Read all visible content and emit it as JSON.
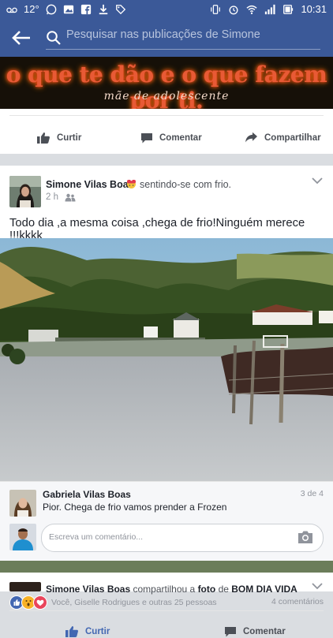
{
  "status_bar": {
    "temperature": "12°",
    "time": "10:31"
  },
  "search": {
    "placeholder": "Pesquisar nas publicações de Simone"
  },
  "banner": {
    "title": "o que te dão e o que fazem por ti.",
    "subtitle": "mãe de adolescente"
  },
  "top_actions": {
    "like": "Curtir",
    "comment": "Comentar",
    "share": "Compartilhar"
  },
  "post": {
    "author": "Simone Vilas Boas",
    "feeling": "sentindo-se com frio.",
    "time": "2 h",
    "text": "Todo dia ,a mesma coisa ,chega de frio!Ninguém merece !!!kkkk",
    "reactions_label": "Você, Giselle Rodrigues e outras 25 pessoas",
    "comments_count": "4 comentários",
    "actions": {
      "like": "Curtir",
      "comment": "Comentar"
    }
  },
  "comment": {
    "author": "Gabriela Vilas Boas",
    "text": "Pior. Chega de frio vamos prender a Frozen",
    "position": "3 de 4"
  },
  "comment_input": {
    "placeholder": "Escreva um comentário..."
  },
  "next_post": {
    "author": "Simone Vilas Boas",
    "action": "compartilhou a",
    "object": "foto",
    "preposition": "de",
    "source": "BOM DIA VIDA"
  },
  "colors": {
    "brand": "#3b5998",
    "like_blue": "#4267b2",
    "background": "#dadde1"
  }
}
